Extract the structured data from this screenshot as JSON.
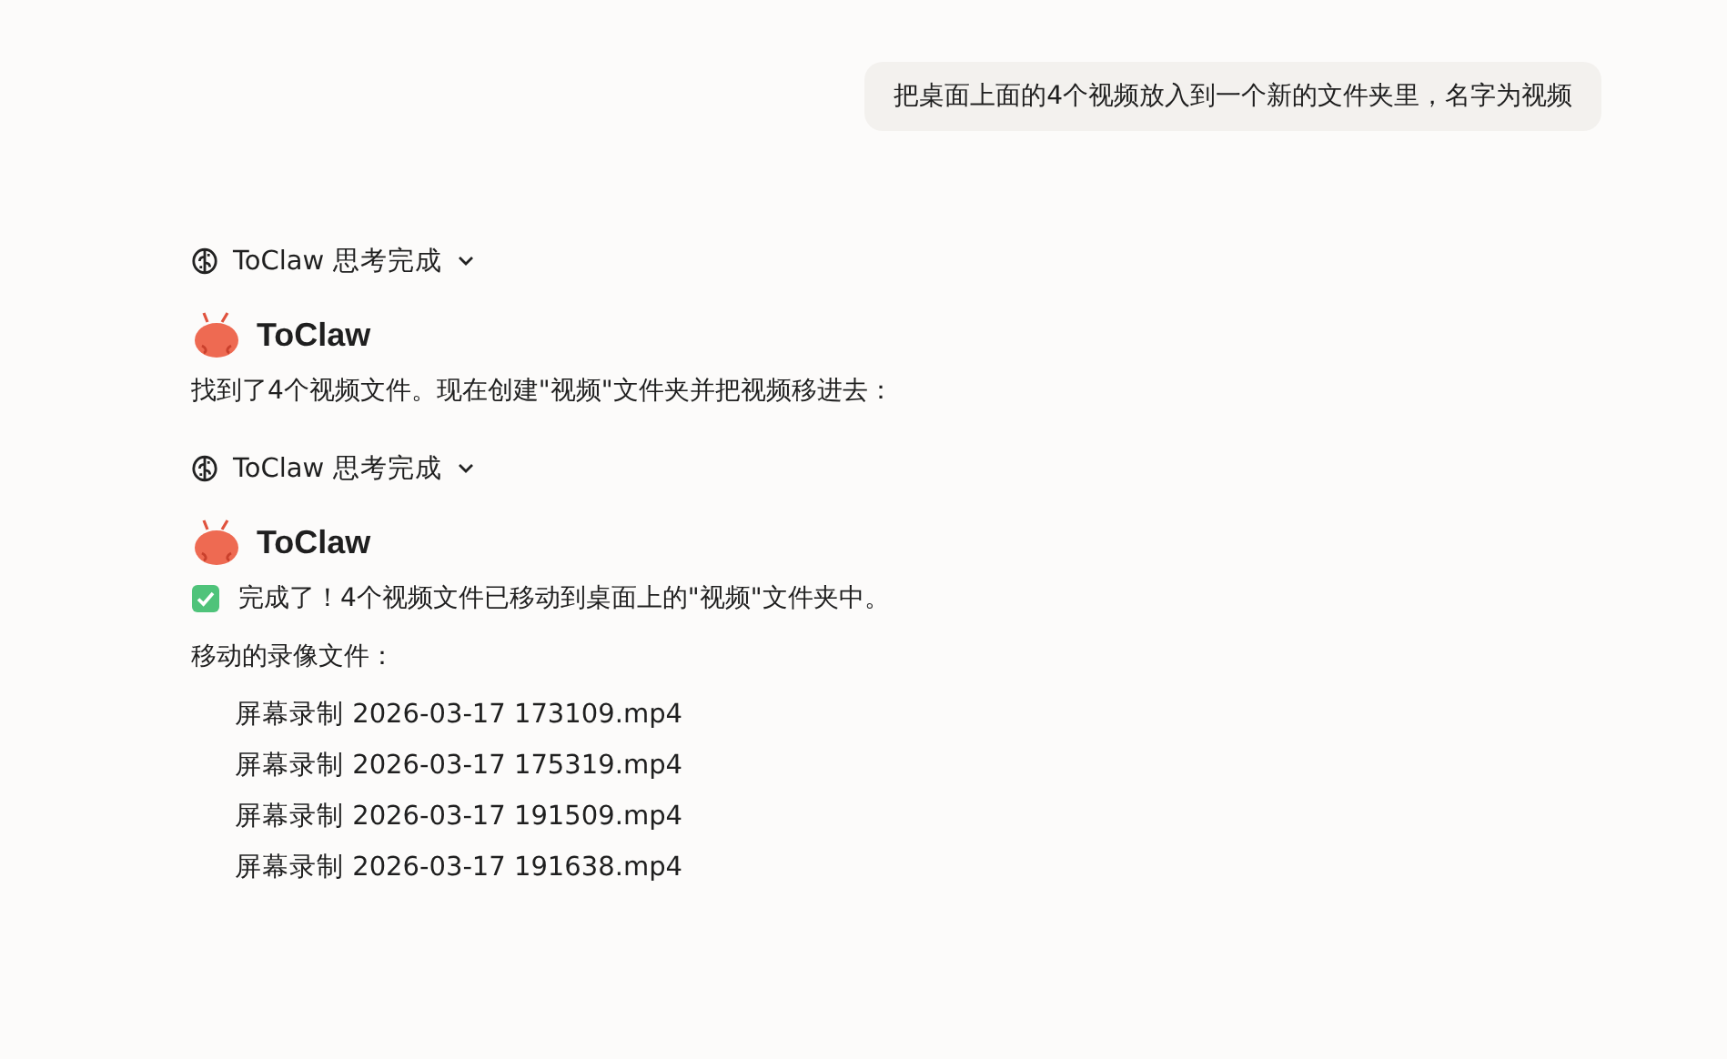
{
  "user_message": "把桌面上面的4个视频放入到一个新的文件夹里，名字为视频",
  "blocks": [
    {
      "kind": "thinking",
      "label": "ToClaw 思考完成",
      "expanded": false
    },
    {
      "kind": "reply",
      "name": "ToClaw",
      "paragraphs": [
        {
          "kind": "plain",
          "text": "找到了4个视频文件。现在创建\"视频\"文件夹并把视频移进去："
        }
      ]
    },
    {
      "kind": "thinking",
      "label": "ToClaw 思考完成",
      "expanded": false
    },
    {
      "kind": "reply",
      "name": "ToClaw",
      "paragraphs": [
        {
          "kind": "done",
          "text": "完成了！4个视频文件已移动到桌面上的\"视频\"文件夹中。"
        },
        {
          "kind": "plain",
          "text": "移动的录像文件："
        }
      ],
      "files": [
        "屏幕录制 2026-03-17 173109.mp4",
        "屏幕录制 2026-03-17 175319.mp4",
        "屏幕录制 2026-03-17 191509.mp4",
        "屏幕录制 2026-03-17 191638.mp4"
      ]
    }
  ]
}
